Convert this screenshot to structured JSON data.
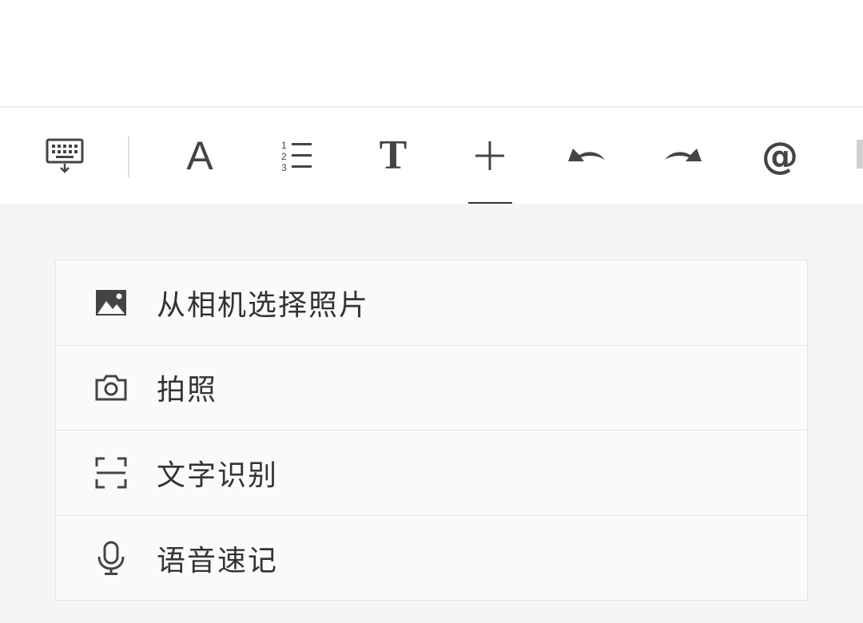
{
  "toolbar": {
    "tools": [
      {
        "name": "keyboard-toggle",
        "icon": "keyboard-hide-icon"
      },
      {
        "name": "font-style",
        "icon": "font-a-icon",
        "glyph": "A"
      },
      {
        "name": "numbered-list",
        "icon": "numbered-list-icon"
      },
      {
        "name": "text-format",
        "icon": "text-t-icon",
        "glyph": "T"
      },
      {
        "name": "insert",
        "icon": "plus-icon",
        "active": true
      },
      {
        "name": "undo",
        "icon": "undo-icon"
      },
      {
        "name": "redo",
        "icon": "redo-icon"
      },
      {
        "name": "mention",
        "icon": "at-icon",
        "glyph": "@"
      }
    ]
  },
  "insert_menu": {
    "items": [
      {
        "label": "从相机选择照片",
        "icon": "image-icon"
      },
      {
        "label": "拍照",
        "icon": "camera-icon"
      },
      {
        "label": "文字识别",
        "icon": "scan-icon"
      },
      {
        "label": "语音速记",
        "icon": "microphone-icon"
      }
    ]
  },
  "colors": {
    "icon": "#444444",
    "text": "#333333",
    "background": "#f5f5f5",
    "toolbar_bg": "#ffffff",
    "menu_bg": "#fafafa"
  }
}
